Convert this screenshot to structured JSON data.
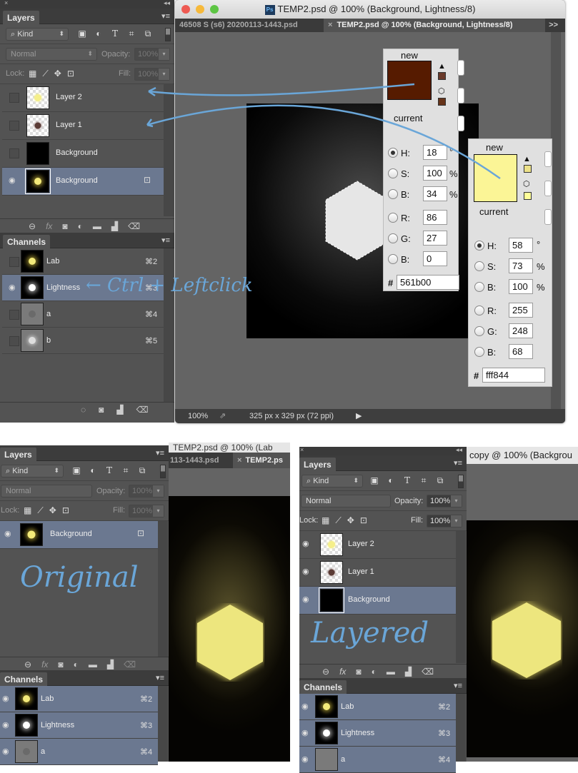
{
  "top_window": {
    "layers_panel": {
      "tab_label": "Layers",
      "kind_label": "Kind",
      "blend_mode": "Normal",
      "opacity_label": "Opacity:",
      "opacity_value": "100%",
      "lock_label": "Lock:",
      "fill_label": "Fill:",
      "fill_value": "100%",
      "layers": [
        {
          "name": "Layer 2",
          "visible": false
        },
        {
          "name": "Layer 1",
          "visible": false
        },
        {
          "name": "Background",
          "visible": false
        },
        {
          "name": "Background",
          "visible": true,
          "selected": true,
          "locked": true
        }
      ]
    },
    "channels_panel": {
      "tab_label": "Channels",
      "channels": [
        {
          "name": "Lab",
          "shortcut": "⌘2",
          "visible": false
        },
        {
          "name": "Lightness",
          "shortcut": "⌘3",
          "visible": true,
          "selected": true
        },
        {
          "name": "a",
          "shortcut": "⌘4",
          "visible": false
        },
        {
          "name": "b",
          "shortcut": "⌘5",
          "visible": false
        }
      ]
    },
    "document": {
      "window_title": "TEMP2.psd @ 100% (Background, Lightness/8)",
      "tabs": [
        {
          "label": "46508 S (s6) 20200113-1443.psd",
          "active": false
        },
        {
          "label": "TEMP2.psd @ 100% (Background, Lightness/8)",
          "active": true
        }
      ],
      "overflow_label": ">>",
      "zoom": "100%",
      "doc_info": "325 px x 329 px (72 ppi)"
    },
    "color_picker_brown": {
      "new_label": "new",
      "current_label": "current",
      "color": "#561b00",
      "H": "18",
      "H_unit": "°",
      "S": "100",
      "S_unit": "%",
      "B": "34",
      "B_unit": "%",
      "R": "86",
      "G": "27",
      "Bl": "0",
      "hex": "561b00",
      "selected_mode": "H"
    },
    "color_picker_yellow": {
      "new_label": "new",
      "current_label": "current",
      "color": "#fff844",
      "H": "58",
      "H_unit": "°",
      "S": "73",
      "S_unit": "%",
      "B": "100",
      "B_unit": "%",
      "R": "255",
      "G": "248",
      "Bl": "68",
      "hex": "fff844",
      "selected_mode": "H"
    },
    "annotation": "← Ctrl + Leftclick"
  },
  "bottom_left": {
    "title_fragment": "TEMP2.psd @ 100% (Lab",
    "tab_fragment_1": "113-1443.psd",
    "tab_fragment_2": "TEMP2.ps",
    "layers_panel": {
      "tab_label": "Layers",
      "kind_label": "Kind",
      "blend_mode": "Normal",
      "opacity_label": "Opacity:",
      "opacity_value": "100%",
      "lock_label": "Lock:",
      "fill_label": "Fill:",
      "fill_value": "100%",
      "layers": [
        {
          "name": "Background",
          "visible": true,
          "selected": true,
          "locked": true
        }
      ]
    },
    "annotation": "Original",
    "channels_panel": {
      "tab_label": "Channels",
      "channels": [
        {
          "name": "Lab",
          "shortcut": "⌘2"
        },
        {
          "name": "Lightness",
          "shortcut": "⌘3"
        },
        {
          "name": "a",
          "shortcut": "⌘4"
        }
      ]
    }
  },
  "bottom_right": {
    "title_fragment": "copy @ 100% (Backgrou",
    "layers_panel": {
      "tab_label": "Layers",
      "kind_label": "Kind",
      "blend_mode": "Normal",
      "opacity_label": "Opacity:",
      "opacity_value": "100%",
      "lock_label": "Lock:",
      "fill_label": "Fill:",
      "fill_value": "100%",
      "layers": [
        {
          "name": "Layer 2",
          "visible": true
        },
        {
          "name": "Layer 1",
          "visible": true
        },
        {
          "name": "Background",
          "visible": true,
          "selected": true
        }
      ]
    },
    "annotation": "Layered",
    "channels_panel": {
      "tab_label": "Channels",
      "channels": [
        {
          "name": "Lab",
          "shortcut": "⌘2"
        },
        {
          "name": "Lightness",
          "shortcut": "⌘3"
        },
        {
          "name": "a",
          "shortcut": "⌘4"
        }
      ]
    }
  },
  "icons": {
    "close": "×",
    "collapse": "◂◂",
    "menu": "▾≡",
    "search": "⌕",
    "image": "▣",
    "adjust": "◐",
    "type": "T",
    "shape": "⌗",
    "smart": "⧉",
    "checker": "▦",
    "brush": "⟋",
    "move": "✥",
    "lock": "🔒",
    "eye": "◉",
    "link": "⊖",
    "fx": "fx",
    "mask": "◙",
    "adj": "◐",
    "folder": "▬",
    "new": "▟",
    "trash": "🗑",
    "selection": "◌"
  }
}
